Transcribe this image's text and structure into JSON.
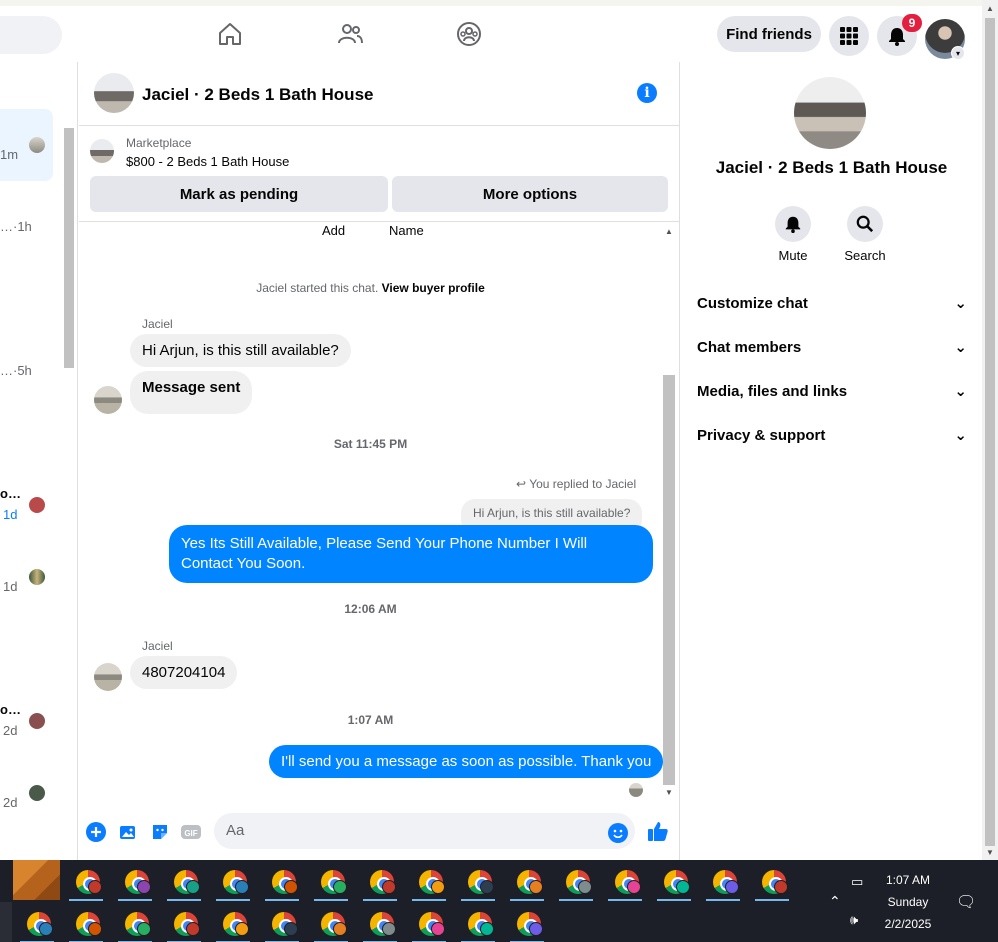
{
  "topnav": {
    "find_friends": "Find friends",
    "notification_count": "9"
  },
  "left_list": {
    "times": [
      "1m",
      "…·1h",
      "…·5h",
      "o…",
      "1d",
      "1d",
      "o…",
      "2d",
      "2d"
    ]
  },
  "chat": {
    "title": "Jaciel · 2 Beds 1 Bath House",
    "marketplace_label": "Marketplace",
    "listing": "$800 - 2 Beds 1 Bath House",
    "mark_pending": "Mark as pending",
    "more_options": "More options",
    "context_add": "Add",
    "context_name": "Name",
    "started_text": "Jaciel started this chat.",
    "buyer_profile": "View buyer profile",
    "sender1": "Jaciel",
    "msg1": "Hi Arjun, is this still available?",
    "msg2": "Message sent",
    "time1": "Sat 11:45 PM",
    "replied_label": "You replied to Jaciel",
    "quoted": "Hi Arjun, is this still available?",
    "msg3": "Yes Its Still Available, Please Send Your Phone Number I Will Contact You Soon.",
    "time2": "12:06 AM",
    "sender2": "Jaciel",
    "msg4": "4807204104",
    "time3": "1:07 AM",
    "msg5": "I'll send you a message as soon as possible. Thank you",
    "composer_placeholder": "Aa",
    "accent_color": "#0084ff"
  },
  "right_panel": {
    "title": "Jaciel · 2 Beds 1 Bath House",
    "mute": "Mute",
    "search": "Search",
    "rows": [
      "Customize chat",
      "Chat members",
      "Media, files and links",
      "Privacy & support"
    ]
  },
  "taskbar": {
    "time": "1:07 AM",
    "day": "Sunday",
    "date": "2/2/2025"
  }
}
